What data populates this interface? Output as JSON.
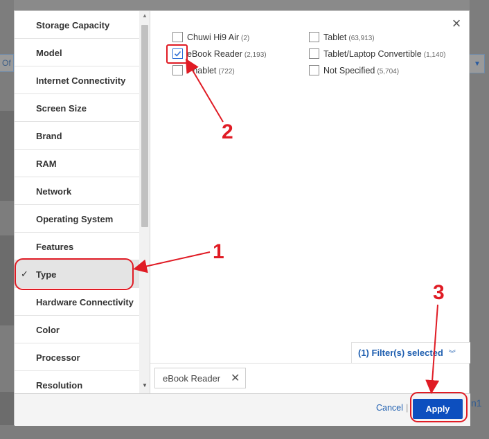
{
  "background": {
    "left_control_text": "Of",
    "right_text": "n1"
  },
  "modal": {
    "categories": [
      {
        "label": "Storage Capacity",
        "selected": false
      },
      {
        "label": "Model",
        "selected": false
      },
      {
        "label": "Internet Connectivity",
        "selected": false
      },
      {
        "label": "Screen Size",
        "selected": false
      },
      {
        "label": "Brand",
        "selected": false
      },
      {
        "label": "RAM",
        "selected": false
      },
      {
        "label": "Network",
        "selected": false
      },
      {
        "label": "Operating System",
        "selected": false
      },
      {
        "label": "Features",
        "selected": false
      },
      {
        "label": "Type",
        "selected": true
      },
      {
        "label": "Hardware Connectivity",
        "selected": false
      },
      {
        "label": "Color",
        "selected": false
      },
      {
        "label": "Processor",
        "selected": false
      },
      {
        "label": "Resolution",
        "selected": false
      }
    ],
    "options_col1": [
      {
        "label": "Chuwi Hi9 Air",
        "count": "(2)",
        "checked": false
      },
      {
        "label": "eBook Reader",
        "count": "(2,193)",
        "checked": true
      },
      {
        "label": "Phablet",
        "count": "(722)",
        "checked": false
      }
    ],
    "options_col2": [
      {
        "label": "Tablet",
        "count": "(63,913)",
        "checked": false
      },
      {
        "label": "Tablet/Laptop Convertible",
        "count": "(1,140)",
        "checked": false
      },
      {
        "label": "Not Specified",
        "count": "(5,704)",
        "checked": false
      }
    ],
    "filters_selected": "(1) Filter(s) selected",
    "chip_label": "eBook Reader",
    "cancel_label": "Cancel",
    "separator": "|",
    "apply_label": "Apply"
  },
  "annotations": {
    "mark1": "1",
    "mark2": "2",
    "mark3": "3",
    "color": "#e01b24"
  },
  "colors": {
    "link_blue": "#1f5fb0",
    "apply_bg": "#0d4fbf",
    "selected_row": "#e4e4e4",
    "check_blue": "#2f6fd6"
  }
}
